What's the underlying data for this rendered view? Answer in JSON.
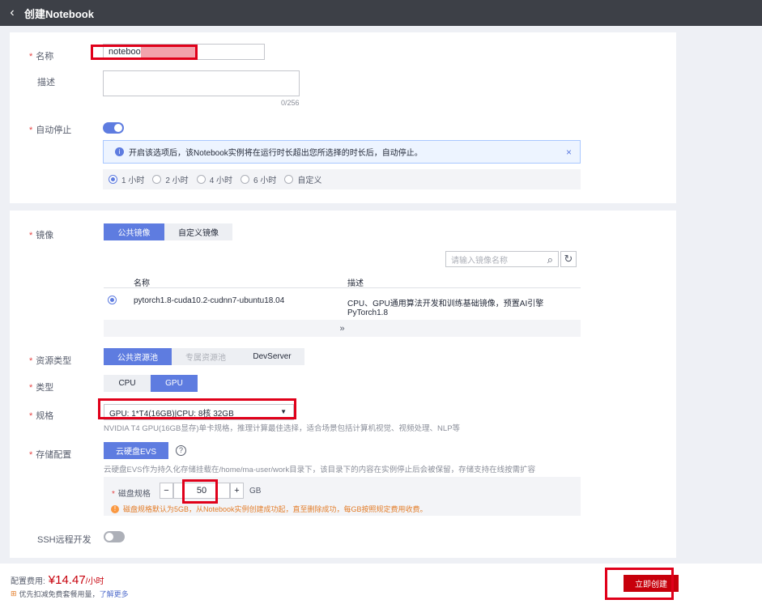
{
  "header": {
    "back_icon": "‹",
    "title": "创建Notebook"
  },
  "form": {
    "name_label": "名称",
    "name_value": "notebook",
    "desc_label": "描述",
    "desc_counter": "0/256",
    "autostop_label": "自动停止",
    "autostop_on": true,
    "info_text": "开启该选项后，该Notebook实例将在运行时长超出您所选择的时长后，自动停止。",
    "durations": [
      "1 小时",
      "2 小时",
      "4 小时",
      "6 小时",
      "自定义"
    ],
    "duration_selected": "1 小时",
    "image_label": "镜像",
    "image_tabs": [
      "公共镜像",
      "自定义镜像"
    ],
    "image_search_placeholder": "请输入镜像名称",
    "image_table": {
      "headers": [
        "名称",
        "描述"
      ],
      "rows": [
        {
          "name": "pytorch1.8-cuda10.2-cudnn7-ubuntu18.04",
          "desc": "CPU、GPU通用算法开发和训练基础镜像，预置AI引擎PyTorch1.8"
        }
      ]
    },
    "pool_label": "资源类型",
    "pool_tabs": [
      "公共资源池",
      "专属资源池",
      "DevServer"
    ],
    "type_label": "类型",
    "type_tabs": [
      "CPU",
      "GPU"
    ],
    "spec_label": "规格",
    "spec_value": "GPU: 1*T4(16GB)|CPU: 8核 32GB",
    "spec_hint": "NVIDIA T4 GPU(16GB显存)单卡规格，推理计算最佳选择，适合场景包括计算机视觉、视频处理、NLP等",
    "storage_label": "存储配置",
    "storage_button": "云硬盘EVS",
    "storage_hint": "云硬盘EVS作为持久化存储挂载在/home/ma-user/work目录下，该目录下的内容在实例停止后会被保留，存储支持在线按需扩容",
    "disk_label": "磁盘规格",
    "disk_minus": "−",
    "disk_value": "50",
    "disk_plus": "+",
    "disk_unit": "GB",
    "disk_warn": "磁盘规格默认为5GB，从Notebook实例创建成功起，直至删除成功，每GB按照规定费用收费。",
    "ssh_label": "SSH远程开发",
    "ssh_on": false
  },
  "footer": {
    "fee_label": "配置费用:",
    "fee_value": "¥14.47",
    "fee_unit": "/小时",
    "discount_text": "优先扣减免费套餐用量，",
    "learn_more": "了解更多",
    "create_button": "立即创建"
  },
  "colors": {
    "accent": "#5e7ce0",
    "brand_red": "#c7000b",
    "price": "#c7000b",
    "topbar": "#3d4047"
  }
}
